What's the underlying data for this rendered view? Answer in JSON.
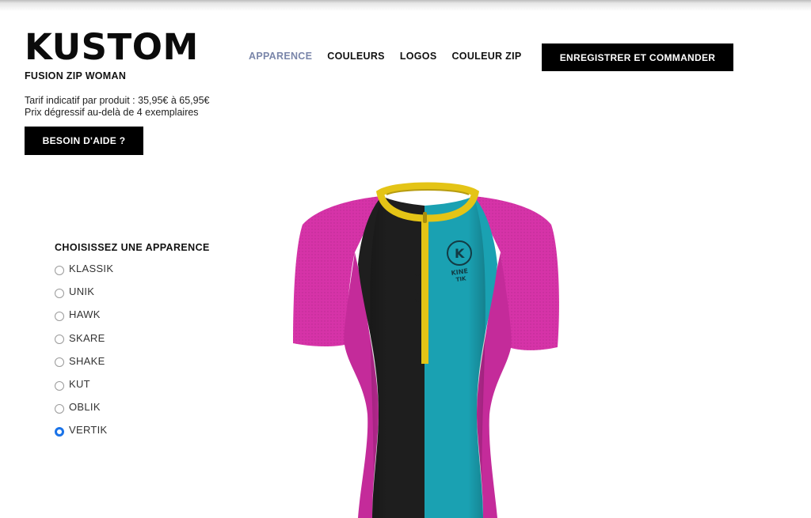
{
  "brand": {
    "name": "KUSTOM"
  },
  "product": {
    "name": "FUSION ZIP WOMAN",
    "price_line1": "Tarif indicatif par produit : 35,95€ à 65,95€",
    "price_line2": "Prix dégressif au-delà de 4 exemplaires"
  },
  "help_button": {
    "label": "BESOIN D'AIDE ?"
  },
  "nav": {
    "items": [
      {
        "label": "APPARENCE",
        "active": true
      },
      {
        "label": "COULEURS",
        "active": false
      },
      {
        "label": "LOGOS",
        "active": false
      },
      {
        "label": "COULEUR ZIP",
        "active": false
      }
    ]
  },
  "order_button": {
    "label": "ENREGISTRER ET COMMANDER"
  },
  "appearance": {
    "title": "CHOISISSEZ UNE APPARENCE",
    "options": [
      {
        "label": "KLASSIK",
        "checked": false
      },
      {
        "label": "UNIK",
        "checked": false
      },
      {
        "label": "HAWK",
        "checked": false
      },
      {
        "label": "SKARE",
        "checked": false
      },
      {
        "label": "SHAKE",
        "checked": false
      },
      {
        "label": "KUT",
        "checked": false
      },
      {
        "label": "OBLIK",
        "checked": false
      },
      {
        "label": "VERTIK",
        "checked": true
      }
    ]
  },
  "jersey": {
    "zip_text": "KINETIK",
    "badge_text_1": "KINE",
    "badge_text_2": "TIK",
    "colors": {
      "sleeves": "#d633a8",
      "left_panel": "#1e1e1e",
      "right_panel": "#1aa1b2",
      "collar": "#e4c416",
      "side_panels": "#c42b9a"
    }
  },
  "colors": {
    "accent_nav": "#7a86aa",
    "radio_checked": "#1a73e8"
  }
}
